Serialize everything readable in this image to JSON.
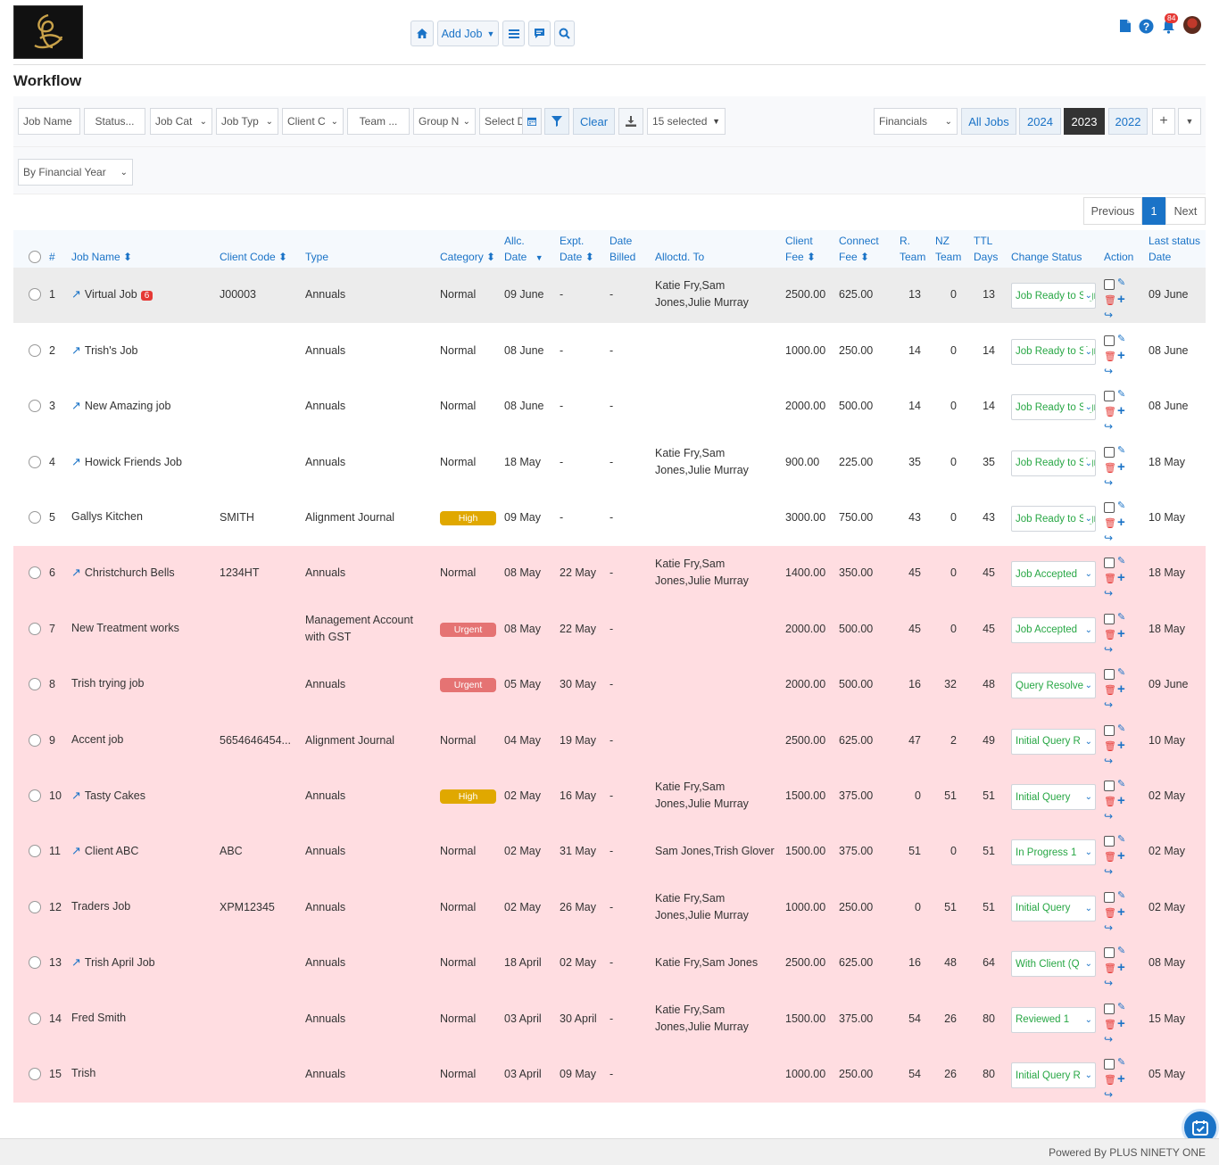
{
  "header": {
    "add_job_label": "Add Job",
    "notifications_count": "84"
  },
  "page_title": "Workflow",
  "filters": {
    "job_name_placeholder": "Job Name",
    "status": "Status...",
    "job_cat": "Job Cat",
    "job_type": "Job Typ",
    "client": "Client C",
    "team": "Team ...",
    "group": "Group N",
    "select_date": "Select D",
    "clear_label": "Clear",
    "columns_selected": "15 selected",
    "financials": "Financials",
    "year_tabs": [
      "All Jobs",
      "2024",
      "2023",
      "2022"
    ],
    "active_year": "2023",
    "period": "By Financial Year"
  },
  "pagination": {
    "previous": "Previous",
    "page": "1",
    "next": "Next"
  },
  "columns": {
    "num": "#",
    "job_name": "Job Name",
    "client_code": "Client Code",
    "type": "Type",
    "category": "Category",
    "allc_date_1": "Allc.",
    "allc_date_2": "Date",
    "expt_date_1": "Expt.",
    "expt_date_2": "Date",
    "date_billed_1": "Date",
    "date_billed_2": "Billed",
    "allocated_to": "Alloctd. To",
    "client_fee_1": "Client",
    "client_fee_2": "Fee",
    "connect_fee_1": "Connect",
    "connect_fee_2": "Fee",
    "r_team_1": "R.",
    "r_team_2": "Team",
    "nz_team_1": "NZ",
    "nz_team_2": "Team",
    "ttl_days_1": "TTL",
    "ttl_days_2": "Days",
    "change_status": "Change Status",
    "action": "Action",
    "last_status_1": "Last status",
    "last_status_2": "Date"
  },
  "rows": [
    {
      "n": "1",
      "name": "Virtual Job",
      "link": true,
      "badge": "6",
      "code": "J00003",
      "type1": "Annuals",
      "type2": "",
      "cat": "Normal",
      "allc": "09 June",
      "expt": "-",
      "billed": "-",
      "alloc1": "Katie Fry,Sam",
      "alloc2": "Jones,Julie Murray",
      "cfee": "2500.00",
      "confee": "625.00",
      "r": "13",
      "nz": "0",
      "ttl": "13",
      "status": "Job Ready to Sign",
      "last": "09 June",
      "bg": "grey"
    },
    {
      "n": "2",
      "name": "Trish's Job",
      "link": true,
      "badge": "",
      "code": "",
      "type1": "Annuals",
      "type2": "",
      "cat": "Normal",
      "allc": "08 June",
      "expt": "-",
      "billed": "-",
      "alloc1": "",
      "alloc2": "",
      "cfee": "1000.00",
      "confee": "250.00",
      "r": "14",
      "nz": "0",
      "ttl": "14",
      "status": "Job Ready to Sign",
      "last": "08 June",
      "bg": "white"
    },
    {
      "n": "3",
      "name": "New Amazing job",
      "link": true,
      "badge": "",
      "code": "",
      "type1": "Annuals",
      "type2": "",
      "cat": "Normal",
      "allc": "08 June",
      "expt": "-",
      "billed": "-",
      "alloc1": "",
      "alloc2": "",
      "cfee": "2000.00",
      "confee": "500.00",
      "r": "14",
      "nz": "0",
      "ttl": "14",
      "status": "Job Ready to Sign",
      "last": "08 June",
      "bg": "white"
    },
    {
      "n": "4",
      "name": "Howick Friends Job",
      "link": true,
      "badge": "",
      "code": "",
      "type1": "Annuals",
      "type2": "",
      "cat": "Normal",
      "allc": "18 May",
      "expt": "-",
      "billed": "-",
      "alloc1": "Katie Fry,Sam",
      "alloc2": "Jones,Julie Murray",
      "cfee": "900.00",
      "confee": "225.00",
      "r": "35",
      "nz": "0",
      "ttl": "35",
      "status": "Job Ready to Sign",
      "last": "18 May",
      "bg": "white"
    },
    {
      "n": "5",
      "name": "Gallys Kitchen",
      "link": false,
      "badge": "",
      "code": "SMITH",
      "type1": "Alignment Journal",
      "type2": "",
      "cat": "High",
      "allc": "09 May",
      "expt": "-",
      "billed": "-",
      "alloc1": "",
      "alloc2": "",
      "cfee": "3000.00",
      "confee": "750.00",
      "r": "43",
      "nz": "0",
      "ttl": "43",
      "status": "Job Ready to Sign",
      "last": "10 May",
      "bg": "white"
    },
    {
      "n": "6",
      "name": "Christchurch Bells",
      "link": true,
      "badge": "",
      "code": "1234HT",
      "type1": "Annuals",
      "type2": "",
      "cat": "Normal",
      "allc": "08 May",
      "expt": "22 May",
      "billed": "-",
      "alloc1": "Katie Fry,Sam",
      "alloc2": "Jones,Julie Murray",
      "cfee": "1400.00",
      "confee": "350.00",
      "r": "45",
      "nz": "0",
      "ttl": "45",
      "status": "Job Accepted",
      "last": "18 May",
      "bg": "pink"
    },
    {
      "n": "7",
      "name": "New Treatment works",
      "link": false,
      "badge": "",
      "code": "",
      "type1": "Management Account",
      "type2": "with GST",
      "cat": "Urgent",
      "allc": "08 May",
      "expt": "22 May",
      "billed": "-",
      "alloc1": "",
      "alloc2": "",
      "cfee": "2000.00",
      "confee": "500.00",
      "r": "45",
      "nz": "0",
      "ttl": "45",
      "status": "Job Accepted",
      "last": "18 May",
      "bg": "pink"
    },
    {
      "n": "8",
      "name": "Trish trying job",
      "link": false,
      "badge": "",
      "code": "",
      "type1": "Annuals",
      "type2": "",
      "cat": "Urgent",
      "allc": "05 May",
      "expt": "30 May",
      "billed": "-",
      "alloc1": "",
      "alloc2": "",
      "cfee": "2000.00",
      "confee": "500.00",
      "r": "16",
      "nz": "32",
      "ttl": "48",
      "status": "Query Resolved",
      "last": "09 June",
      "bg": "pink"
    },
    {
      "n": "9",
      "name": "Accent job",
      "link": false,
      "badge": "",
      "code": "5654646454...",
      "type1": "Alignment Journal",
      "type2": "",
      "cat": "Normal",
      "allc": "04 May",
      "expt": "19 May",
      "billed": "-",
      "alloc1": "",
      "alloc2": "",
      "cfee": "2500.00",
      "confee": "625.00",
      "r": "47",
      "nz": "2",
      "ttl": "49",
      "status": "Initial Query R",
      "last": "10 May",
      "bg": "pink"
    },
    {
      "n": "10",
      "name": "Tasty Cakes",
      "link": true,
      "badge": "",
      "code": "",
      "type1": "Annuals",
      "type2": "",
      "cat": "High",
      "allc": "02 May",
      "expt": "16 May",
      "billed": "-",
      "alloc1": "Katie Fry,Sam",
      "alloc2": "Jones,Julie Murray",
      "cfee": "1500.00",
      "confee": "375.00",
      "r": "0",
      "nz": "51",
      "ttl": "51",
      "status": "Initial Query",
      "last": "02 May",
      "bg": "pink"
    },
    {
      "n": "11",
      "name": "Client ABC",
      "link": true,
      "badge": "",
      "code": "ABC",
      "type1": "Annuals",
      "type2": "",
      "cat": "Normal",
      "allc": "02 May",
      "expt": "31 May",
      "billed": "-",
      "alloc1": "Sam Jones,Trish Glover",
      "alloc2": "",
      "cfee": "1500.00",
      "confee": "375.00",
      "r": "51",
      "nz": "0",
      "ttl": "51",
      "status": "In Progress 1",
      "last": "02 May",
      "bg": "pink"
    },
    {
      "n": "12",
      "name": "Traders Job",
      "link": false,
      "badge": "",
      "code": "XPM12345",
      "type1": "Annuals",
      "type2": "",
      "cat": "Normal",
      "allc": "02 May",
      "expt": "26 May",
      "billed": "-",
      "alloc1": "Katie Fry,Sam",
      "alloc2": "Jones,Julie Murray",
      "cfee": "1000.00",
      "confee": "250.00",
      "r": "0",
      "nz": "51",
      "ttl": "51",
      "status": "Initial Query",
      "last": "02 May",
      "bg": "pink"
    },
    {
      "n": "13",
      "name": "Trish April Job",
      "link": true,
      "badge": "",
      "code": "",
      "type1": "Annuals",
      "type2": "",
      "cat": "Normal",
      "allc": "18 April",
      "expt": "02 May",
      "billed": "-",
      "alloc1": "Katie Fry,Sam Jones",
      "alloc2": "",
      "cfee": "2500.00",
      "confee": "625.00",
      "r": "16",
      "nz": "48",
      "ttl": "64",
      "status": "With Client (Q",
      "last": "08 May",
      "bg": "pink"
    },
    {
      "n": "14",
      "name": "Fred Smith",
      "link": false,
      "badge": "",
      "code": "",
      "type1": "Annuals",
      "type2": "",
      "cat": "Normal",
      "allc": "03 April",
      "expt": "30 April",
      "billed": "-",
      "alloc1": "Katie Fry,Sam",
      "alloc2": "Jones,Julie Murray",
      "cfee": "1500.00",
      "confee": "375.00",
      "r": "54",
      "nz": "26",
      "ttl": "80",
      "status": "Reviewed 1",
      "last": "15 May",
      "bg": "pink"
    },
    {
      "n": "15",
      "name": "Trish",
      "link": false,
      "badge": "",
      "code": "",
      "type1": "Annuals",
      "type2": "",
      "cat": "Normal",
      "allc": "03 April",
      "expt": "09 May",
      "billed": "-",
      "alloc1": "",
      "alloc2": "",
      "cfee": "1000.00",
      "confee": "250.00",
      "r": "54",
      "nz": "26",
      "ttl": "80",
      "status": "Initial Query R",
      "last": "05 May",
      "bg": "pink"
    }
  ],
  "colors": {
    "accent": "#1a73c7",
    "pink_row": "#ffdde1",
    "grey_row": "#ececec",
    "high": "#e0a800",
    "urgent": "#e57373",
    "status_text": "#28a745"
  },
  "footer": {
    "powered_by": "Powered By PLUS NINETY ONE"
  }
}
